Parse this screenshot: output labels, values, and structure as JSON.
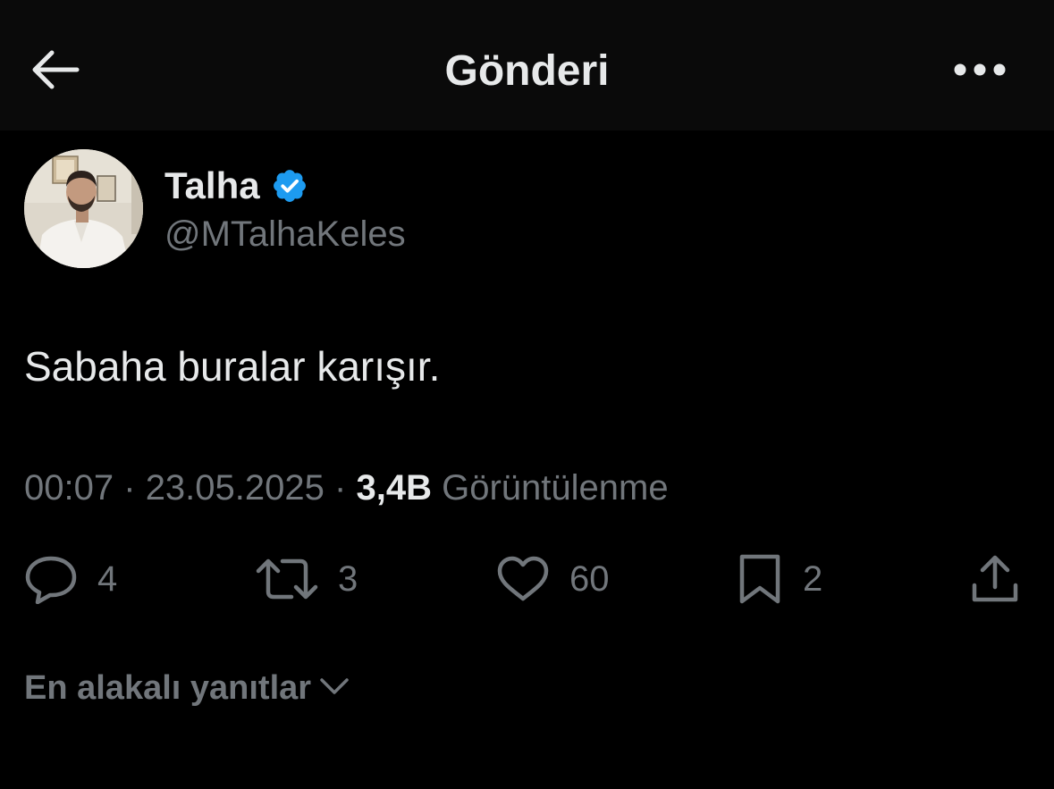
{
  "header": {
    "title": "Gönderi",
    "back_icon": "arrow-left-icon",
    "more_icon": "more-horizontal-icon"
  },
  "author": {
    "name": "Talha",
    "handle": "@MTalhaKeles",
    "verified": true,
    "verified_color": "#1d9bf0"
  },
  "post": {
    "text": "Sabaha buralar karışır.",
    "time": "00:07",
    "date": "23.05.2025",
    "separator": "·",
    "views_count": "3,4B",
    "views_label": "Görüntülenme"
  },
  "actions": {
    "replies": {
      "icon": "comment-icon",
      "count": "4"
    },
    "reposts": {
      "icon": "repost-icon",
      "count": "3"
    },
    "likes": {
      "icon": "heart-icon",
      "count": "60"
    },
    "bookmarks": {
      "icon": "bookmark-icon",
      "count": "2"
    },
    "share": {
      "icon": "share-icon"
    }
  },
  "replies_sort": {
    "label": "En alakalı yanıtlar",
    "icon": "chevron-down-icon"
  },
  "colors": {
    "background": "#000000",
    "header_background": "#0a0a0a",
    "primary_text": "#e7e9ea",
    "secondary_text": "#71767b",
    "accent": "#1d9bf0"
  }
}
